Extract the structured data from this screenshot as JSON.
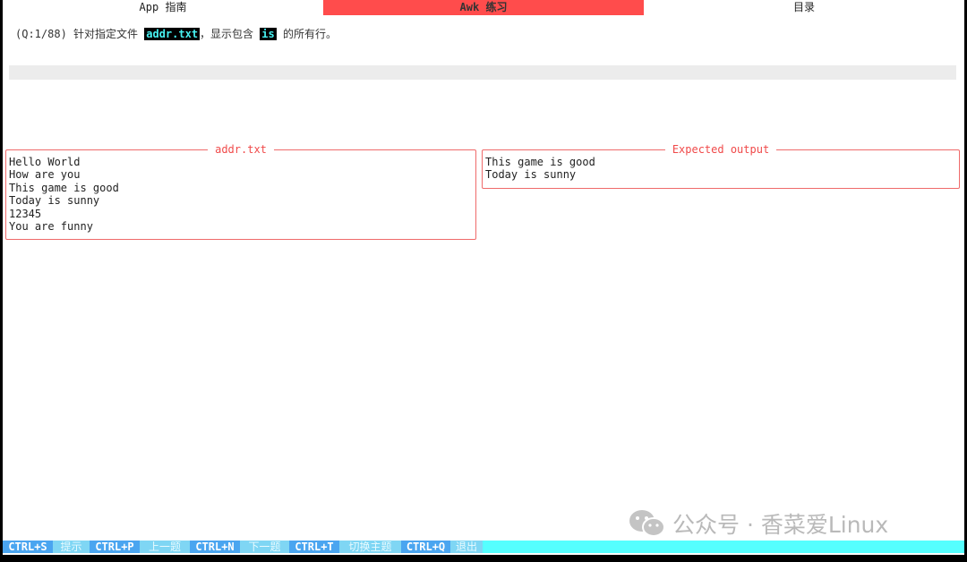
{
  "tabs": [
    {
      "label": "App 指南",
      "active": false
    },
    {
      "label": "Awk 练习",
      "active": true
    },
    {
      "label": "目录",
      "active": false
    }
  ],
  "question": {
    "prefix": "(Q:1/88) 针对指定文件 ",
    "file": "addr.txt",
    "middle": "，显示包含 ",
    "keyword": "is",
    "suffix": " 的所有行。"
  },
  "input": {
    "value": ""
  },
  "file_panel": {
    "title": "addr.txt",
    "lines": [
      "Hello World",
      "How are you",
      "This game is good",
      "Today is sunny",
      "12345",
      "You are funny"
    ]
  },
  "output_panel": {
    "title": "Expected output",
    "lines": [
      "This game is good",
      "Today is sunny"
    ]
  },
  "watermark": {
    "text": "公众号 · 香菜爱Linux"
  },
  "footer": [
    {
      "key": "CTRL+S",
      "label": "提示"
    },
    {
      "key": "CTRL+P",
      "label": "上一题"
    },
    {
      "key": "CTRL+N",
      "label": "下一题"
    },
    {
      "key": "CTRL+T",
      "label": "切换主题"
    },
    {
      "key": "CTRL+Q",
      "label": "退出"
    }
  ],
  "colors": {
    "accent": "#ff4c4c",
    "panel_border": "#ef6a6a",
    "footer_bg": "#55ffff",
    "footer_key": "#4aa5f0",
    "highlight": "#48f2f2"
  }
}
